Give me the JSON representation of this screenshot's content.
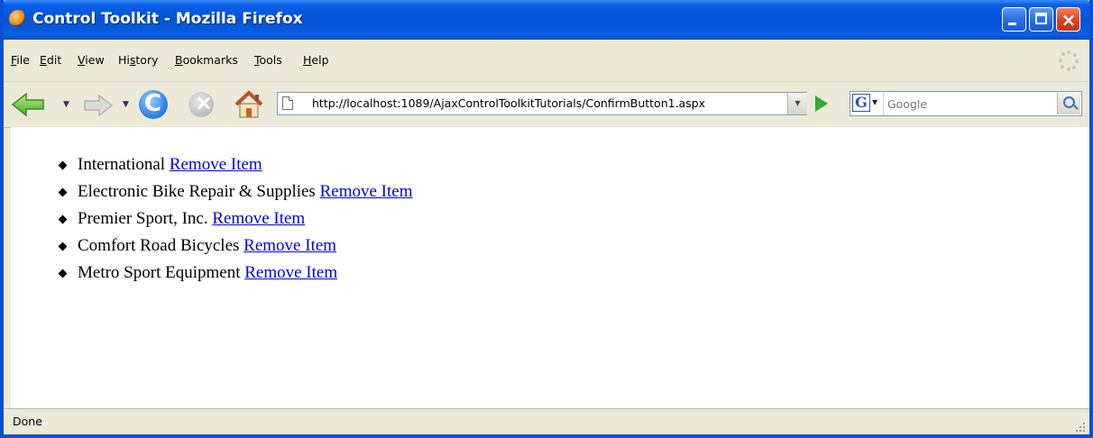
{
  "window": {
    "title": "Control Toolkit - Mozilla Firefox"
  },
  "menu": {
    "items": [
      {
        "key": "F",
        "rest": "ile"
      },
      {
        "key": "E",
        "rest": "dit"
      },
      {
        "key": "V",
        "rest": "iew"
      },
      {
        "pre": "Hi",
        "key": "s",
        "rest": "tory"
      },
      {
        "key": "B",
        "rest": "ookmarks"
      },
      {
        "key": "T",
        "rest": "ools"
      },
      {
        "key": "H",
        "rest": "elp"
      }
    ]
  },
  "navigation": {
    "url": "http://localhost:1089/AjaxControlToolkitTutorials/ConfirmButton1.aspx",
    "search_placeholder": "Google",
    "search_engine_letter": "G"
  },
  "content": {
    "link_text": "Remove Item",
    "items": [
      {
        "name": "International",
        "link": "Remove Item"
      },
      {
        "name": "Electronic Bike Repair & Supplies",
        "link": "Remove Item"
      },
      {
        "name": "Premier Sport, Inc.",
        "link": "Remove Item"
      },
      {
        "name": "Comfort Road Bicycles",
        "link": "Remove Item"
      },
      {
        "name": "Metro Sport Equipment",
        "link": "Remove Item"
      }
    ]
  },
  "status": {
    "text": "Done"
  },
  "colors": {
    "titlebar": "#0453d6",
    "link": "#0000ee",
    "chrome": "#ece9d8"
  }
}
